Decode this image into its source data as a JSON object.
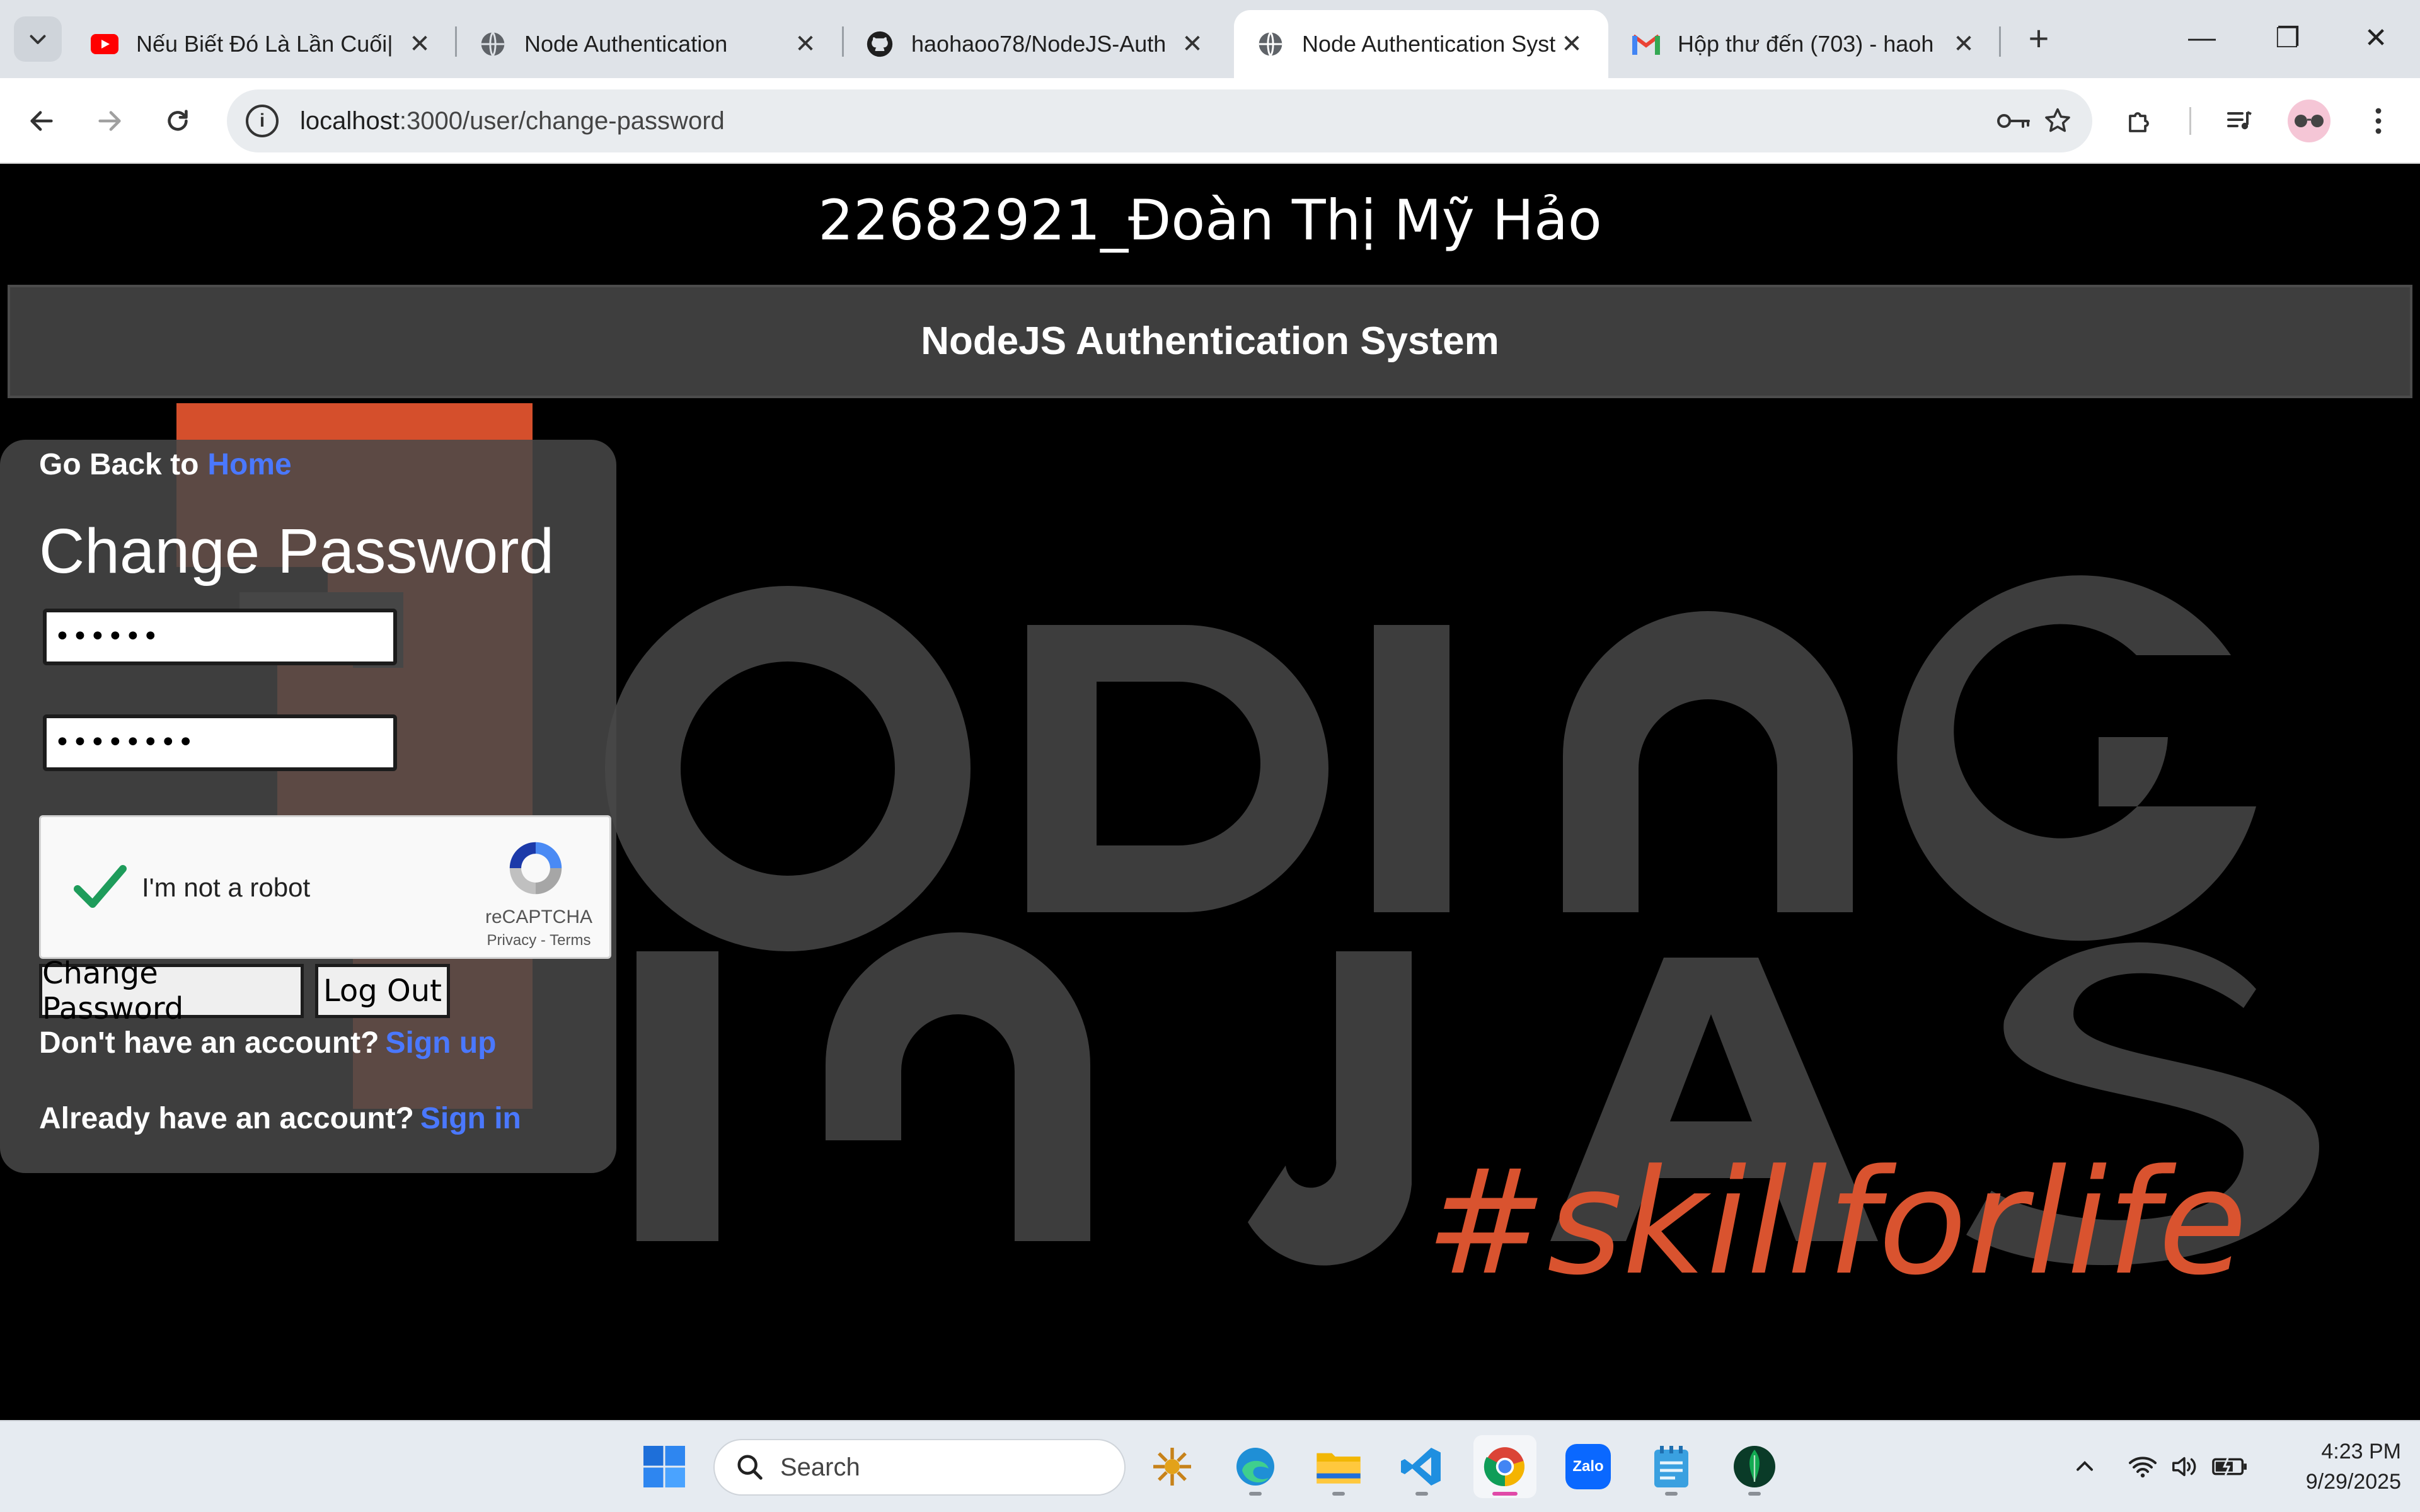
{
  "browser": {
    "tabs": [
      {
        "title": "Nếu Biết Đó Là Lần Cuối|",
        "favicon": "youtube-icon",
        "active": false
      },
      {
        "title": "Node Authentication",
        "favicon": "globe-icon",
        "active": false
      },
      {
        "title": "haohaoo78/NodeJS-Auth",
        "favicon": "github-icon",
        "active": false
      },
      {
        "title": "Node Authentication Syst",
        "favicon": "globe-icon",
        "active": true
      },
      {
        "title": "Hộp thư đến (703) - haoh",
        "favicon": "gmail-icon",
        "active": false
      }
    ],
    "new_tab_label": "+",
    "url_host": "localhost",
    "url_path": ":3000/user/change-password",
    "window_controls": {
      "minimize": "—",
      "restore": "❐",
      "close": "✕"
    }
  },
  "page": {
    "student_header": "22682921_Đoàn Thị Mỹ Hảo",
    "app_title": "NodeJS Authentication System",
    "go_back_text": "Go Back to",
    "home_link": "Home",
    "form_title": "Change Password",
    "current_password_value": "••••••",
    "new_password_value": "••••••••",
    "recaptcha": {
      "label": "I'm not a robot",
      "brand": "reCAPTCHA",
      "privacy": "Privacy",
      "separator": " - ",
      "terms": "Terms",
      "checked": true
    },
    "change_password_button": "Change Password",
    "logout_button": "Log Out",
    "signup_prompt": "Don't have an account?",
    "signup_link": "Sign up",
    "signin_prompt": "Already have an account?",
    "signin_link": "Sign in",
    "background": {
      "word_top": "ODING",
      "word_bottom": "INJAS",
      "tagline": "#skillforlife",
      "tagline_color": "#d9532f",
      "letters_color": "#3d3d3d"
    },
    "colors": {
      "link": "#4a78ff",
      "nav_bg": "#3e3e3e",
      "accent_orange": "#d9532f"
    }
  },
  "taskbar": {
    "search_placeholder": "Search",
    "apps": [
      "start-icon",
      "widget-icon",
      "edge-icon",
      "file-explorer-icon",
      "vscode-icon",
      "chrome-icon",
      "zalo-icon",
      "notepad-icon",
      "mongodb-compass-icon"
    ],
    "zalo_label": "Zalo",
    "time": "4:23 PM",
    "date": "9/29/2025"
  }
}
